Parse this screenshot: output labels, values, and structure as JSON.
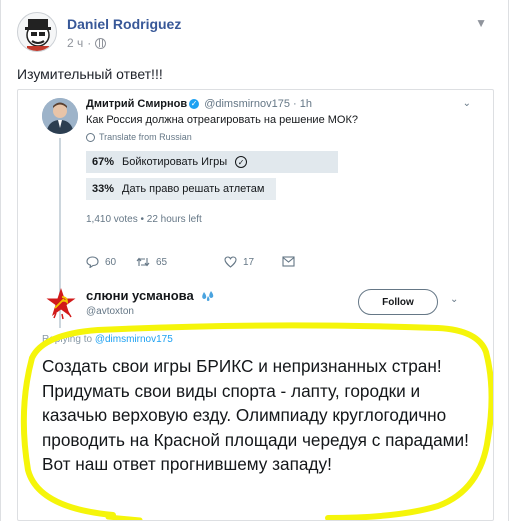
{
  "post": {
    "author": "Daniel Rodriguez",
    "time": "2 ч",
    "text": "Изумительный ответ!!!"
  },
  "tweet1": {
    "name": "Дмитрий Смирнов",
    "handle": "@dimsmirnov175",
    "time": "· 1h",
    "text": "Как Россия должна отреагировать на решение МОК?",
    "translate": "Translate from Russian",
    "poll": [
      {
        "percent": "67%",
        "label": "Бойкотировать Игры",
        "fraction": 0.67,
        "winner": true
      },
      {
        "percent": "33%",
        "label": "Дать право решать атлетам",
        "fraction": 0.33,
        "winner": false
      }
    ],
    "poll_meta": "1,410 votes • 22 hours left",
    "actions": {
      "replies": "60",
      "retweets": "65",
      "likes": "17"
    }
  },
  "tweet2": {
    "name": "слюни усманова",
    "handle": "@avtoxton",
    "follow_label": "Follow",
    "reply_prefix": "Replying to ",
    "reply_mention": "@dimsmirnov175",
    "text": "Создать свои игры БРИКС и непризнанных стран! Придумать свои виды спорта - лапту, городки и казачью верховую езду. Олимпиаду круглогодично проводить на Красной площади чередуя с парадами! Вот наш ответ прогнившему западу!"
  },
  "colors": {
    "facebook_link": "#385898",
    "twitter_blue": "#1da1f2",
    "annotation_yellow": "#f5f50a",
    "poll_bar": "#e1e8ed"
  }
}
